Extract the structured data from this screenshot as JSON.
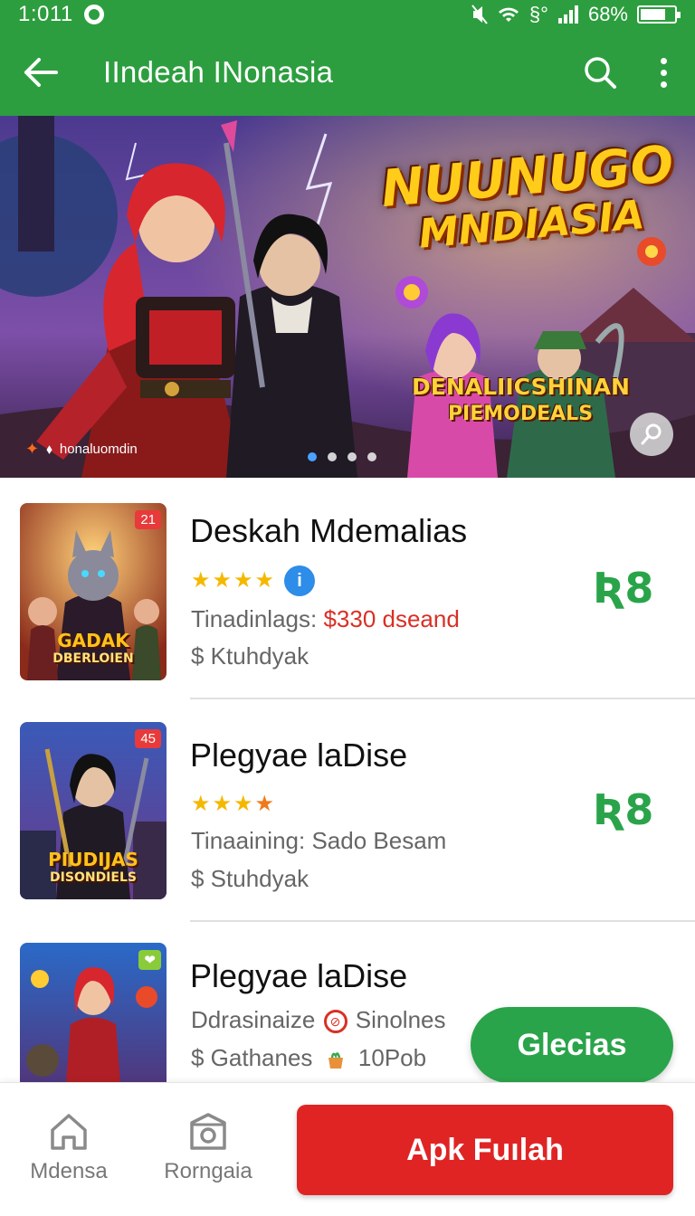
{
  "status_bar": {
    "time": "1:011",
    "battery": "68%",
    "signal_text": "§°"
  },
  "app_bar": {
    "title": "IIndeah INonasia"
  },
  "banner": {
    "title_line1": "NUUNUGO",
    "title_line2": "MNDIASIA",
    "subtitle_line1": "DENALIICSHINAN",
    "subtitle_line2": "PIEMODEALS",
    "brand": "honaluomdin",
    "page_count": 4,
    "active_page": 1
  },
  "items": [
    {
      "title": "Deskah Mdemalias",
      "rating": 4,
      "score": "Ʀ8",
      "meta1_label": "Tinadinlags: ",
      "meta1_value": "$330 dseand",
      "meta2": "$ Ktuhdyak",
      "thumb_badge": "21",
      "thumb_caption1": "GADAK",
      "thumb_caption2": "DBERLOIEN"
    },
    {
      "title": "Plegyae laDise",
      "rating": 4,
      "score": "Ʀ8",
      "meta1_label": "Tinaaining: Sado Besam",
      "meta2": "$ Stuhdyak",
      "thumb_badge": "45",
      "thumb_caption1": "PIUDIJAS",
      "thumb_caption2": "DISONDIELS"
    },
    {
      "title": "Plegyae laDise",
      "meta1_part1": "Ddrasinaize",
      "meta1_part2": "Sinolnes",
      "meta2_part1": "$ Gathanes",
      "meta2_part2": "10Pob",
      "thumb_badge": "❤"
    }
  ],
  "action_button": "Glecias",
  "bottom_nav": {
    "home_label": "Mdensa",
    "second_label": "Rorngaia",
    "cta_label": "Apk Fuılah"
  },
  "colors": {
    "primary_green": "#2d9e3f",
    "accent_green": "#2aa44a",
    "cta_red": "#e02424",
    "price_red": "#d93025",
    "star_yellow": "#f5b800"
  }
}
